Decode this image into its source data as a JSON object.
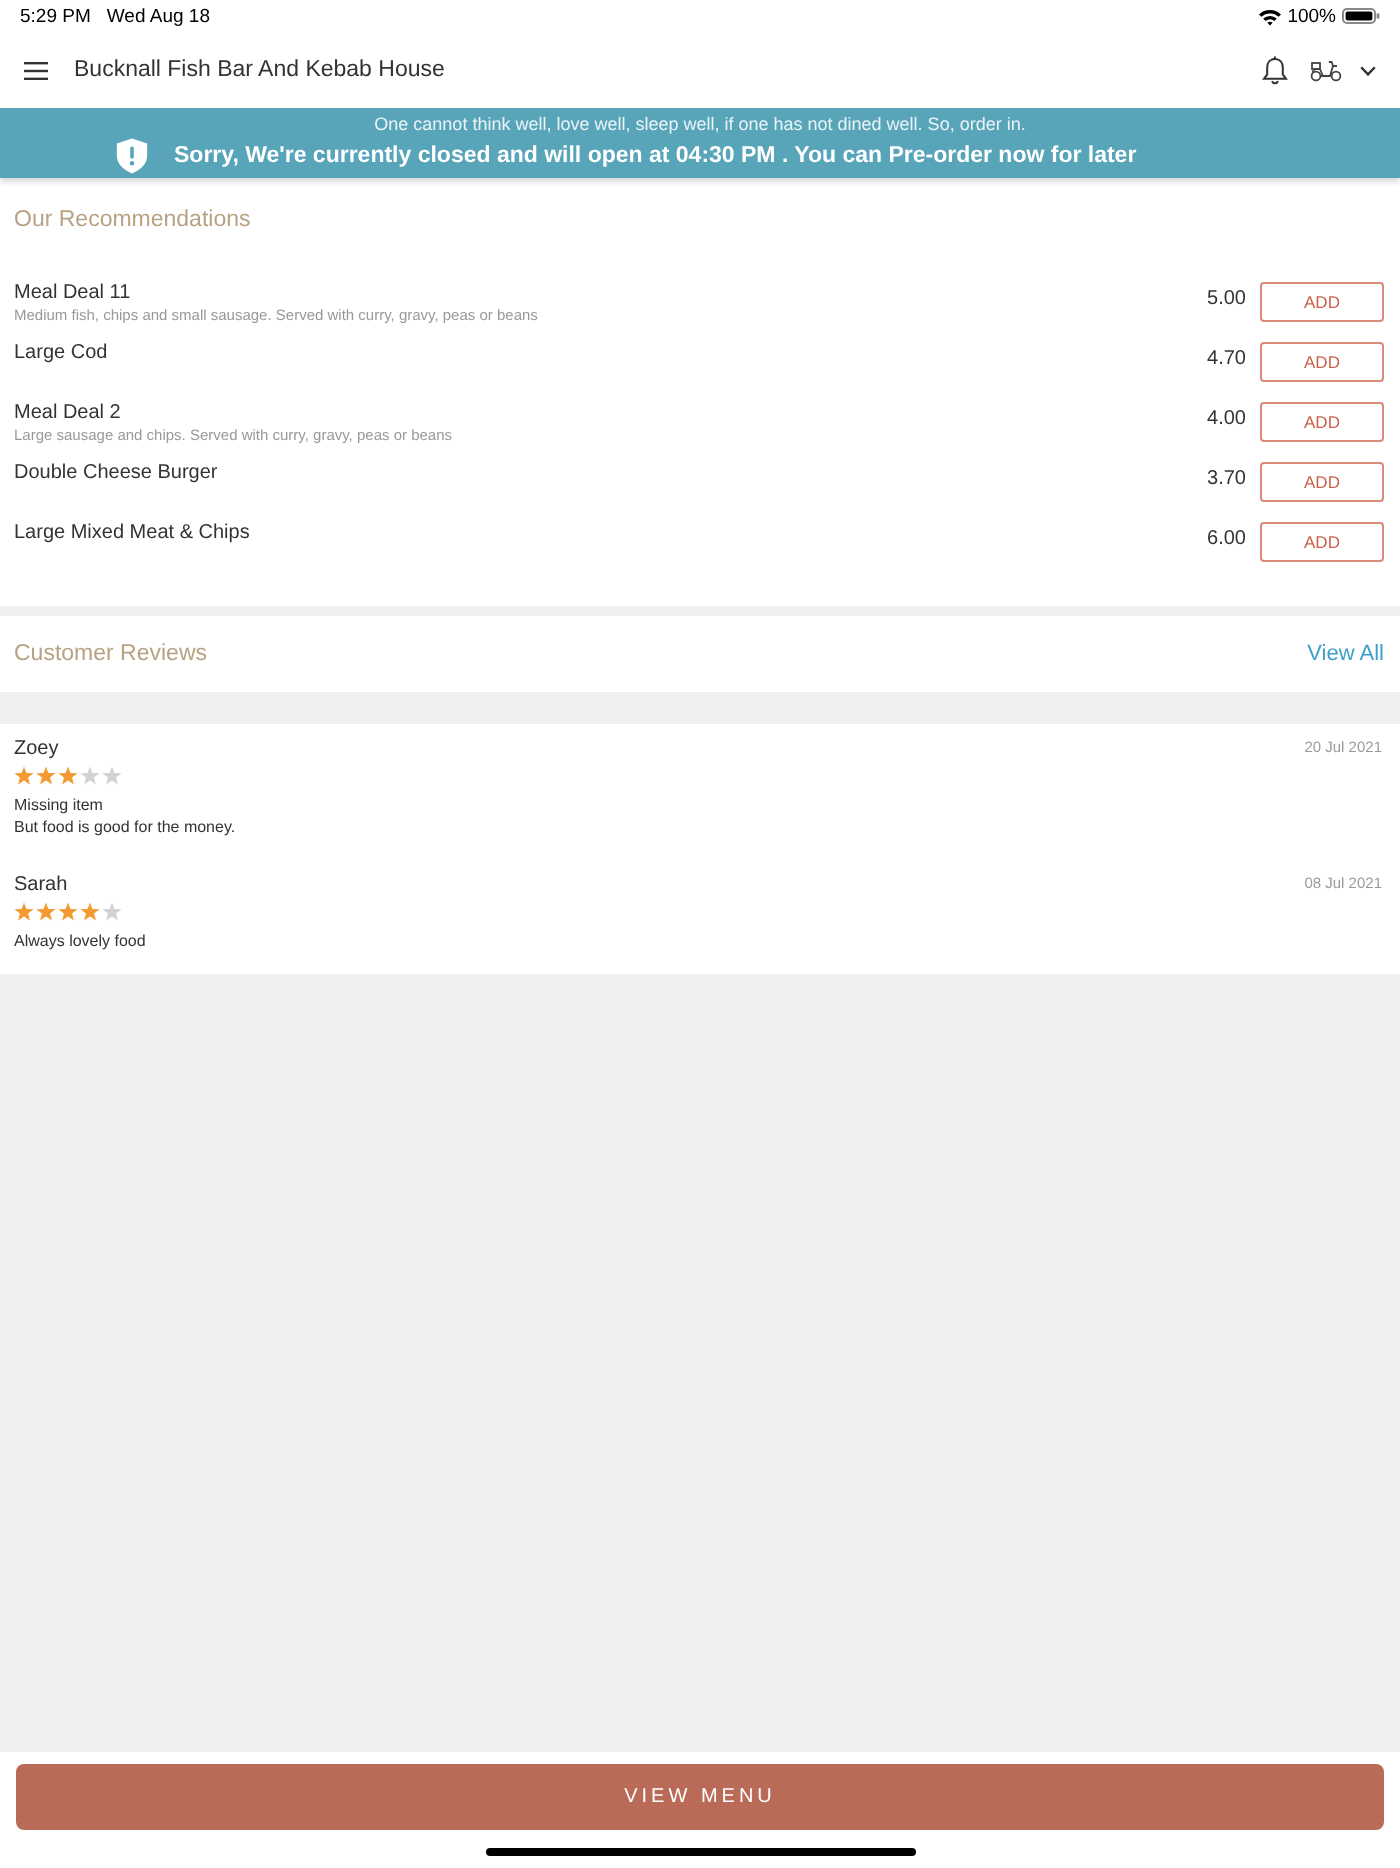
{
  "status_bar": {
    "time": "5:29 PM",
    "date": "Wed Aug 18",
    "battery": "100%"
  },
  "header": {
    "title": "Bucknall Fish Bar And Kebab House"
  },
  "banner": {
    "tagline": "One cannot think well, love well, sleep well, if one has not dined well. So, order in.",
    "message": "Sorry, We're currently closed and will open at 04:30 PM . You can Pre-order now for later"
  },
  "recommendations": {
    "title": "Our Recommendations",
    "items": [
      {
        "name": "Meal Deal 11",
        "description": "Medium fish, chips and small sausage. Served with curry, gravy, peas or beans",
        "price": "5.00",
        "button": "ADD"
      },
      {
        "name": "Large Cod",
        "price": "4.70",
        "button": "ADD"
      },
      {
        "name": "Meal Deal 2",
        "description": "Large sausage and chips. Served with curry, gravy, peas or beans",
        "price": "4.00",
        "button": "ADD"
      },
      {
        "name": "Double Cheese Burger",
        "price": "3.70",
        "button": "ADD"
      },
      {
        "name": "Large Mixed Meat & Chips",
        "price": "6.00",
        "button": "ADD"
      }
    ]
  },
  "reviews": {
    "title": "Customer Reviews",
    "link": "View All",
    "items": [
      {
        "author": "Zoey",
        "stars": 3,
        "date": "20 Jul 2021",
        "text": "Missing item\nBut food is good for the money."
      },
      {
        "author": "Sarah",
        "stars": 4,
        "date": "08 Jul 2021",
        "text": "Always lovely food"
      }
    ]
  },
  "footer": {
    "button": "VIEW MENU"
  }
}
